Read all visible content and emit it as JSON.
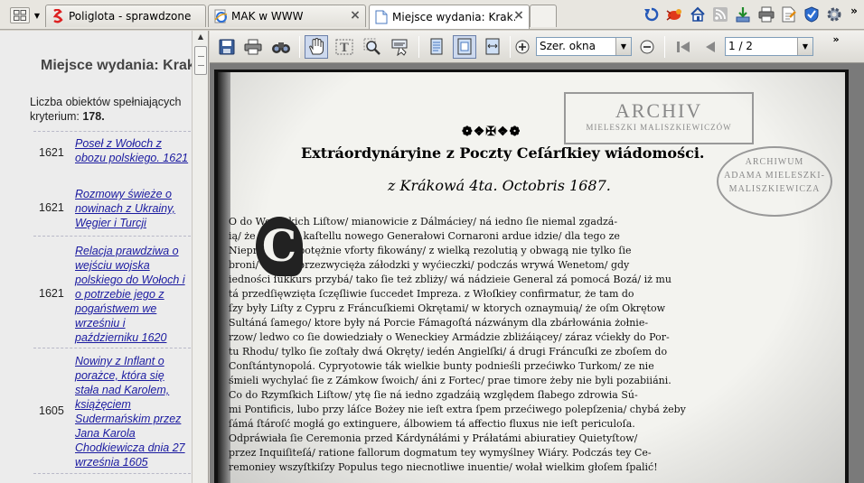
{
  "tabs": [
    {
      "label": "Poliglota - sprawdzone…",
      "favicon": "poliglota-icon",
      "active": false
    },
    {
      "label": "MAK w WWW",
      "favicon": "ie-page-icon",
      "active": false
    },
    {
      "label": "Miejsce wydania: Krak…",
      "favicon": "document-icon",
      "active": true
    }
  ],
  "toolbar_icons": [
    "back-icon",
    "bug-icon",
    "home-icon",
    "rss-icon",
    "download-icon",
    "print-icon",
    "page-tools-icon",
    "safety-icon",
    "gear-icon"
  ],
  "chevron_label": "»",
  "left_panel": {
    "header": "Miejsce wydania: Kraków",
    "result_count_label": "Liczba obiektów spełniających kryterium:",
    "result_count_value": "178.",
    "results": [
      {
        "year": "1621",
        "title": "Poseł z Wołoch z obozu polskiego. 1621"
      },
      {
        "year": "1621",
        "title": "Rozmowy świeże o nowinach z Ukrainy, Węgier i Turcji"
      },
      {
        "year": "1621",
        "title": "Relacja prawdziwa o wejściu wojska polskiego do Wołoch i o potrzebie jego z pogaństwem we wrześniu i październiku 1620"
      },
      {
        "year": "1605",
        "title": "Nowiny z Inflant o porażce, która się stała nad Karolem, książęciem Sudermańskim przez Jana Karola Chodkiewicza dnia 27 września 1605"
      }
    ]
  },
  "viewer_toolbar": {
    "zoom_select": "Szer. okna",
    "page_select": "1 / 2",
    "chevron": "»"
  },
  "document": {
    "ornament": "❁❖✠❖❁",
    "heading": "Extráordynáryine z Poczty Ceſárſkiey wiádomości.",
    "subheading": "z Krákowá 4ta. Octobris 1687.",
    "stamp_rect_title": "ARCHIV",
    "stamp_rect_sub": "MIELESZKI MALISZKIEWICZÓW",
    "stamp_oval_lines": [
      "ARCHIWUM",
      "ADAMA MIELESZKI-",
      "MALISZKIEWICZA"
    ],
    "drop_cap": "C",
    "lines": [
      "            O do Weneckich Liſtow/ mianowicie z Dálmáciey/ ná iedno ſie niemal zgadzá-",
      "            ią/ że Impreza kaſtellu nowego Generałowi Cornaroni ardue idzie/ dla tego ze",
      "            Nieprzyiaciel potężnie vforty fikowány/ z wielką rezolutią y obwagą nie tylko ſie",
      "            broni/ ále też przezwycięża záłodzki y wyćieczki/ podczás wrywá Wenetom/ gdy",
      "iedności ſukkurs przybá/ tako ſie też zbliży/ wá nádzieie General zá pomocá Bozá/ iż mu",
      "tá przedſięwzięta ſczęſliwie ſuccedet Impreza.     z Włoſkiey confirmatur, że tam do",
      "ſzy były Liſty z Cypru z Fráncuſkiemi Okrętami/ w ktorych oznaymuią/ że oſm Okrętow",
      "Sultáná ſamego/ ktore były ná Porcie Fámagoſtá názwánym dla zbárłowánia żołnie-",
      "rzow/ ledwo co ſie dowiedziały o Weneckiey Armádzie zbliżáiącey/ záraz vćiekły do Por-",
      "tu Rhodu/ tylko ſie zoſtały dwá Okręty/ iedén Angielſki/ á drugi Fráncuſki ze zboſem do",
      "Conſtántynopolá.     Cypryotowie ták wielkie bunty podnieśli przećiwko Turkom/ ze nie",
      "śmieli wychylać ſie z Zámkow ſwoich/ áni z Fortec/ prae timore żeby nie byli pozabiiáni.",
      "     Co do Rzymſkich Liſtow/ ytę ſie ná iedno zgadzáią względem ſłabego zdrowia Sú-",
      "mi Pontificis, lubo przy láſce Bożey nie ieſt extra ſpem przećiwego polepſzenia/ chybá żeby",
      "ſámá ſtároſć mogłá go extinguere, álbowiem tá affectio fluxus nie ieſt periculoſa.",
      "     Odpráwiała ſie Ceremonia przed Kárdynáłámi y Práłatámi abiuratiey Quietyſtow/",
      "przez Inquiſiteſá/ ratione fallorum dogmatum tey wymyślney Wiáry.    Podczás tey Ce-",
      "remoniey wszyſtkiſzy Populus tego niecnotliwe inuentie/ wołał wielkim głoſem ſpalić!"
    ]
  }
}
